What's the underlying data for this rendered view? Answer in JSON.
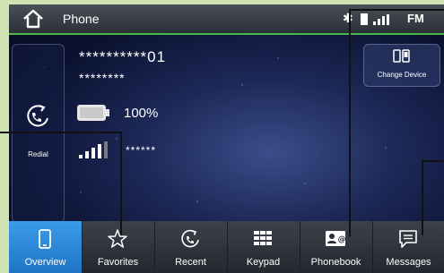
{
  "header": {
    "title": "Phone",
    "bluetooth_glyph": "✱",
    "radio_label": "FM"
  },
  "device": {
    "number": "**********01",
    "name": "********",
    "battery": "100%",
    "carrier": "******"
  },
  "redial": {
    "label": "Redial"
  },
  "change_device": {
    "label": "Change Device"
  },
  "nav": {
    "items": [
      {
        "label": "Overview",
        "icon": "phone-icon",
        "active": true
      },
      {
        "label": "Favorites",
        "icon": "star-icon",
        "active": false
      },
      {
        "label": "Recent",
        "icon": "recent-calls-icon",
        "active": false
      },
      {
        "label": "Keypad",
        "icon": "keypad-icon",
        "active": false
      },
      {
        "label": "Phonebook",
        "icon": "phonebook-icon",
        "active": false
      },
      {
        "label": "Messages",
        "icon": "message-icon",
        "active": false
      }
    ]
  },
  "colors": {
    "accent_green": "#48b848",
    "active_tab": "#2a88dc",
    "background_outer": "#cfe3b3"
  }
}
